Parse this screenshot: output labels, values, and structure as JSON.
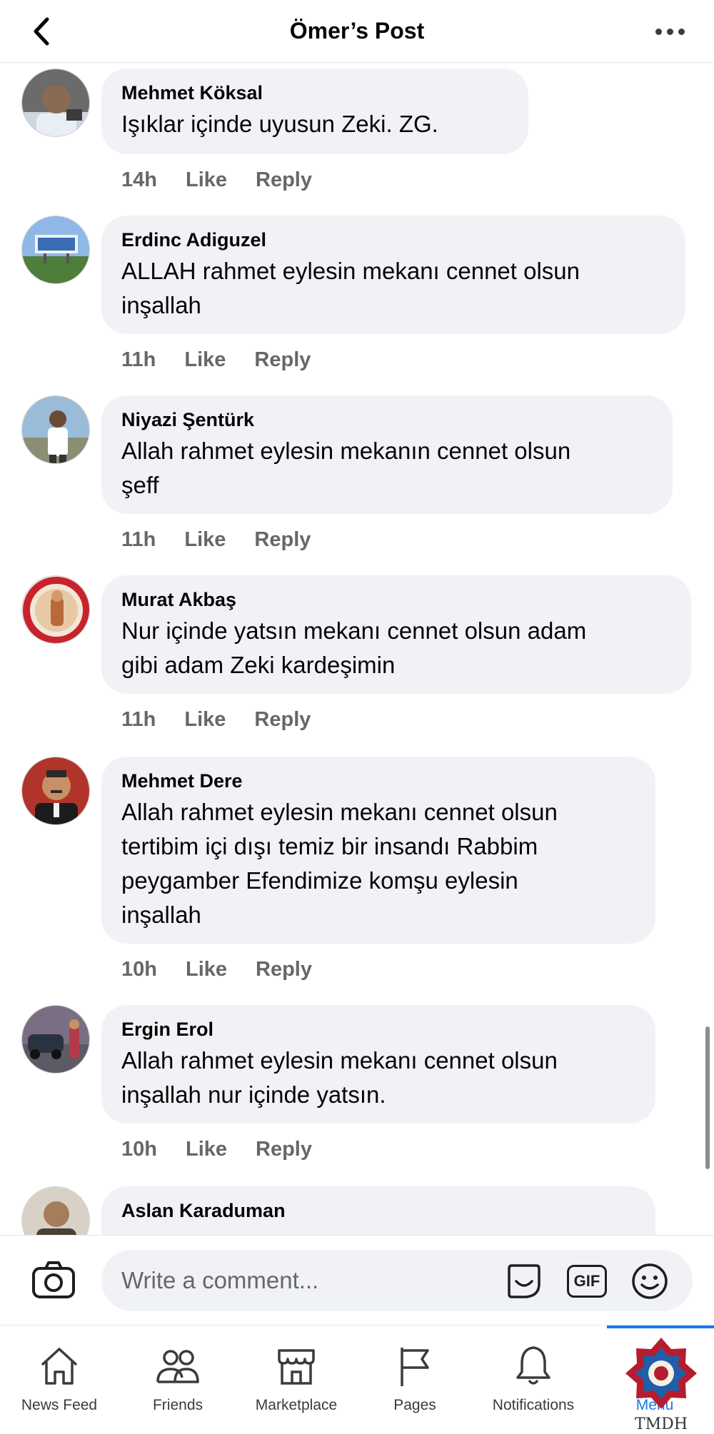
{
  "header": {
    "title": "Ömer’s Post"
  },
  "comments": [
    {
      "name": "Mehmet Köksal",
      "lines": [
        "Işıklar içinde uyusun Zeki.   ZG."
      ],
      "time": "14h"
    },
    {
      "name": "Erdinc Adiguzel",
      "lines": [
        "ALLAH rahmet eylesin mekanı cennet olsun",
        "inşallah"
      ],
      "time": "11h"
    },
    {
      "name": "Niyazi Şentürk",
      "lines": [
        "Allah rahmet eylesin mekanın cennet olsun",
        "şeff"
      ],
      "time": "11h"
    },
    {
      "name": "Murat Akbaş",
      "lines": [
        "Nur içinde yatsın mekanı cennet olsun adam",
        "gibi adam Zeki kardeşimin"
      ],
      "time": "11h"
    },
    {
      "name": "Mehmet Dere",
      "lines": [
        "Allah rahmet eylesin mekanı cennet olsun",
        "tertibim içi dışı temiz bir insandı Rabbim",
        "peygamber Efendimize komşu eylesin",
        "inşallah"
      ],
      "time": "10h"
    },
    {
      "name": "Ergin Erol",
      "lines": [
        "Allah rahmet eylesin mekanı cennet olsun",
        "inşallah nur içinde yatsın."
      ],
      "time": "10h"
    },
    {
      "name": "Aslan Karaduman",
      "lines": [],
      "time": ""
    }
  ],
  "actions": {
    "like": "Like",
    "reply": "Reply"
  },
  "composer": {
    "placeholder": "Write a comment...",
    "gif": "GIF"
  },
  "nav": {
    "items": [
      {
        "label": "News Feed",
        "icon": "home-icon"
      },
      {
        "label": "Friends",
        "icon": "friends-icon"
      },
      {
        "label": "Marketplace",
        "icon": "marketplace-icon"
      },
      {
        "label": "Pages",
        "icon": "flag-icon"
      },
      {
        "label": "Notifications",
        "icon": "bell-icon"
      },
      {
        "label": "Menu",
        "icon": "menu-icon"
      }
    ]
  },
  "watermark": "TMDH"
}
